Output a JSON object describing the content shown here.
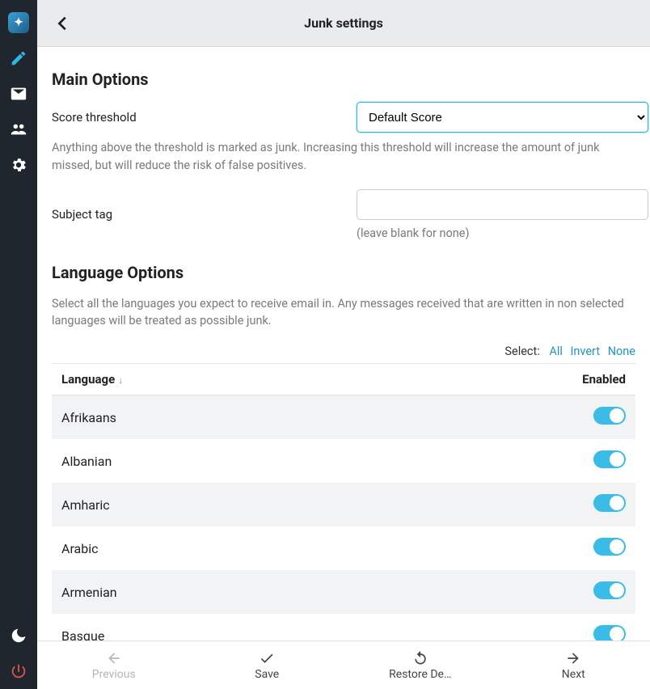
{
  "header": {
    "title": "Junk settings"
  },
  "sections": {
    "main_options_title": "Main Options",
    "language_options_title": "Language Options"
  },
  "score": {
    "label": "Score threshold",
    "selected": "Default Score",
    "help": "Anything above the threshold is marked as junk. Increasing this threshold will increase the amount of junk missed, but will reduce the risk of false positives."
  },
  "subject_tag": {
    "label": "Subject tag",
    "value": "",
    "hint": "(leave blank for none)"
  },
  "language_help": "Select all the languages you expect to receive email in. Any messages received that are written in non selected languages will be treated as possible junk.",
  "select_links": {
    "label": "Select:",
    "all": "All",
    "invert": "Invert",
    "none": "None"
  },
  "table": {
    "col_language": "Language",
    "col_enabled": "Enabled",
    "rows": [
      {
        "name": "Afrikaans",
        "enabled": true
      },
      {
        "name": "Albanian",
        "enabled": true
      },
      {
        "name": "Amharic",
        "enabled": true
      },
      {
        "name": "Arabic",
        "enabled": true
      },
      {
        "name": "Armenian",
        "enabled": true
      },
      {
        "name": "Basque",
        "enabled": true
      }
    ]
  },
  "footer": {
    "previous": "Previous",
    "save": "Save",
    "restore": "Restore De…",
    "next": "Next"
  }
}
